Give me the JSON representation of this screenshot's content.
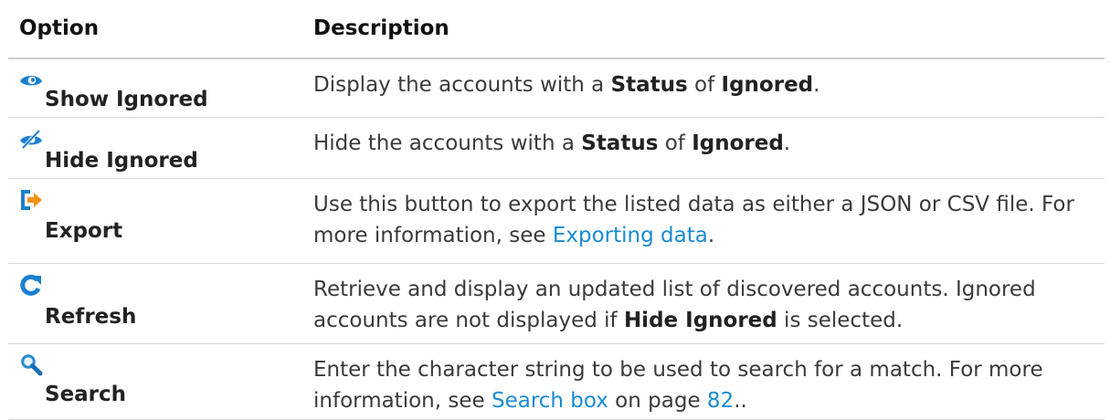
{
  "table": {
    "header": {
      "option": "Option",
      "description": "Description"
    },
    "rows": [
      {
        "icon": "eye-icon",
        "label": "Show Ignored",
        "desc": [
          {
            "text": "Display the accounts with a "
          },
          {
            "text": "Status",
            "bold": true
          },
          {
            "text": " of "
          },
          {
            "text": "Ignored",
            "bold": true
          },
          {
            "text": "."
          }
        ]
      },
      {
        "icon": "eye-slash-icon",
        "label": "Hide Ignored",
        "desc": [
          {
            "text": "Hide the accounts with a "
          },
          {
            "text": "Status",
            "bold": true
          },
          {
            "text": " of "
          },
          {
            "text": "Ignored",
            "bold": true
          },
          {
            "text": "."
          }
        ]
      },
      {
        "icon": "export-icon",
        "label": "Export",
        "desc": [
          {
            "text": "Use this button to export the listed data as either a JSON or CSV file. For more information, see "
          },
          {
            "text": "Exporting data",
            "link": true
          },
          {
            "text": "."
          }
        ]
      },
      {
        "icon": "refresh-icon",
        "label": "Refresh",
        "desc": [
          {
            "text": "Retrieve and display an updated list of discovered accounts. Ignored accounts are not displayed if "
          },
          {
            "text": "Hide Ignored",
            "bold": true
          },
          {
            "text": " is selected."
          }
        ]
      },
      {
        "icon": "search-icon",
        "label": "Search",
        "desc": [
          {
            "text": "Enter the character string to be used to search for a match. For more information, see "
          },
          {
            "text": "Search box",
            "link": true
          },
          {
            "text": " on page "
          },
          {
            "text": "82",
            "link": true
          },
          {
            "text": ".."
          }
        ]
      }
    ]
  }
}
